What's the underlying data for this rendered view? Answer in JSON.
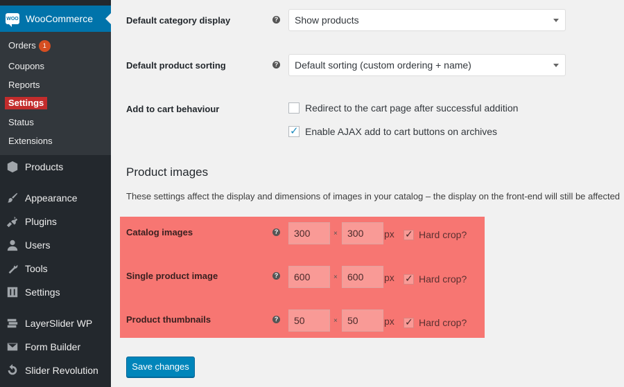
{
  "sidebar": {
    "woocommerce_label": "WooCommerce",
    "woo_logo_text": "WOO",
    "submenu": [
      {
        "label": "Orders",
        "badge": "1"
      },
      {
        "label": "Coupons"
      },
      {
        "label": "Reports"
      },
      {
        "label": "Settings"
      },
      {
        "label": "Status"
      },
      {
        "label": "Extensions"
      }
    ],
    "menu": [
      {
        "label": "Products",
        "icon": "box-icon"
      },
      {
        "label": "Appearance",
        "icon": "paintbrush-icon"
      },
      {
        "label": "Plugins",
        "icon": "plug-icon"
      },
      {
        "label": "Users",
        "icon": "user-icon"
      },
      {
        "label": "Tools",
        "icon": "wrench-icon"
      },
      {
        "label": "Settings",
        "icon": "sliders-icon"
      },
      {
        "label": "LayerSlider WP",
        "icon": "layers-icon"
      },
      {
        "label": "Form Builder",
        "icon": "envelope-icon"
      },
      {
        "label": "Slider Revolution",
        "icon": "refresh-icon"
      }
    ]
  },
  "settings": {
    "category_display": {
      "label": "Default category display",
      "value": "Show products"
    },
    "product_sorting": {
      "label": "Default product sorting",
      "value": "Default sorting (custom ordering + name)"
    },
    "add_to_cart": {
      "label": "Add to cart behaviour",
      "redirect": {
        "label": "Redirect to the cart page after successful addition",
        "checked": false
      },
      "ajax": {
        "label": "Enable AJAX add to cart buttons on archives",
        "checked": true
      }
    }
  },
  "product_images": {
    "title": "Product images",
    "description": "These settings affect the display and dimensions of images in your catalog – the display on the front-end will still be affected",
    "times_symbol": "×",
    "unit": "px",
    "hard_crop_label": "Hard crop?",
    "rows": [
      {
        "label": "Catalog images",
        "width": "300",
        "height": "300",
        "hard_crop": true
      },
      {
        "label": "Single product image",
        "width": "600",
        "height": "600",
        "hard_crop": true
      },
      {
        "label": "Product thumbnails",
        "width": "50",
        "height": "50",
        "hard_crop": true
      }
    ]
  },
  "help_symbol": "?",
  "save_label": "Save changes",
  "colors": {
    "highlight": "#f77672",
    "accent": "#0073aa",
    "active_settings": "#c32c2c",
    "button": "#0085ba"
  }
}
